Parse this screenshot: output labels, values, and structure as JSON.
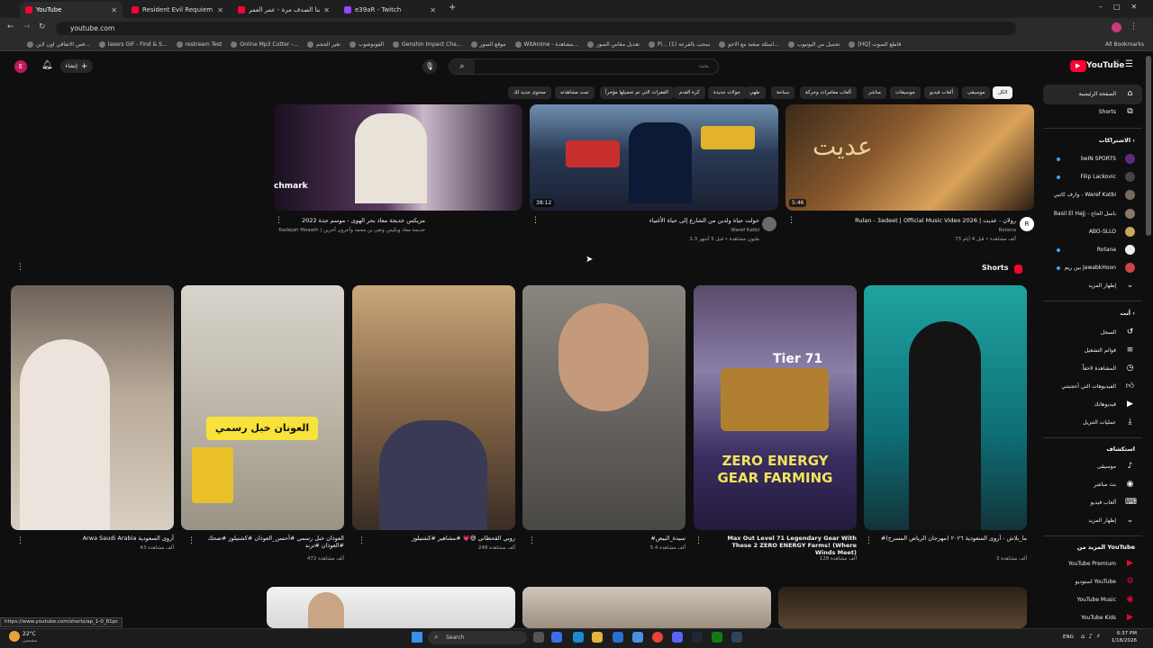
{
  "browser": {
    "tabs": [
      {
        "title": "YouTube"
      },
      {
        "title": "Resident Evil Requiem 💎 زوبام"
      },
      {
        "title": "تجمعنا الصدف مرة - عمر العمر"
      },
      {
        "title": "e39aR - Twitch"
      }
    ],
    "new_tab": "+",
    "url": "youtube.com",
    "bookmarks": [
      "فص الاتفاقي اون لاين...",
      "lasers GIF - Find & S...",
      "restream Test",
      "Online Mp3 Cutter -...",
      "تغير الحجم",
      "الفوتوشوب",
      "Genshin Impact Cha...",
      "موقع الصور",
      "WitAnime - مشاهدة...",
      "تعديل مقاس الصور",
      "Pi... (1) سحب بالقرعة",
      "اسئلة صعبة مع الاجو...",
      "تحميل من اليوتيوب",
      "[HQ] قاطع الصوت",
      "All Bookmarks"
    ]
  },
  "youtube": {
    "logo": "YouTube",
    "logo_region": "SA",
    "search_placeholder": "بحث",
    "create_label": "إنشاء",
    "avatar_letter": "E",
    "chips": [
      "الكل",
      "محتوى جديد لك",
      "تمت مشاهدته",
      "الفقرات التي تم تحميلها مؤخراً",
      "كرة القدم",
      "جولات جديدة",
      "طهي",
      "سباحة",
      "ألعاب مغامرات وحركة",
      "مباشر",
      "موسيقات",
      "ألعاب فيديو",
      "موسيقى",
      "الكل المحتوى"
    ],
    "top_videos": [
      {
        "title": "Rulan - 3adeet | Official Music Video 2026 | روﻻن - عديت",
        "channel": "Rotana",
        "meta": "73 ألف مشاهدة • قبل 4 أيام",
        "duration": "5:46",
        "thumb_text": "عديت"
      },
      {
        "title": "حولت حياة ولدين من الشارع إلى حياة الأغنياء",
        "channel": "Waref Katbi",
        "meta": "1.3 مليون مشاهدة • قبل 5 أشهر",
        "duration": "38:12",
        "thumb_text": ""
      },
      {
        "title": "مزيكس خديجة معاذ بحر الهوى - موسم جدة 2022",
        "channel": "Kadejah Moaath | خديجة معاذ ويكيس ونغي بن محمد وآخرون آخرين",
        "meta": "",
        "duration": "",
        "thumb_text": "chmark"
      }
    ],
    "shorts_heading": "Shorts",
    "shorts": [
      {
        "title": "Arwa Saudi Arabia أروى السعودية",
        "views": "43 ألف مشاهدة",
        "thumb_text": ""
      },
      {
        "title": "العوذان خبل رسمي #أحسن_العوذان #كشتيلوز #ضحك #العوذان #ترند",
        "views": "472 ألف مشاهدة",
        "thumb_text": "العونان خبل رسمي"
      },
      {
        "title": "روبي القحطاني 😅💗 #مشاهير #كشتيلوز",
        "views": "248 ألف مشاهدة",
        "thumb_text": ""
      },
      {
        "title": "#سيدة_البيض",
        "views": "5.4 ألف مشاهدة",
        "thumb_text": ""
      },
      {
        "title": "Max Out Level 71 Legendary Gear With These 2 ZERO ENERGY Farms! (Where Winds Meet)",
        "views": "128 ألف مشاهدة",
        "thumb_text": "ZERO ENERGY GEAR FARMING",
        "thumb_tier": "Tier 71"
      },
      {
        "title": "#ما_بلاش - أروى السعودية ٢٠٢٦ (مهرجان الرياض المسرح)",
        "views": "3 ألف مشاهدة",
        "thumb_text": ""
      }
    ],
    "sidebar": {
      "home": "الصفحة الرئيسية",
      "shorts": "Shorts",
      "subs_heading": "الاشتراكات",
      "subs": [
        "beIN SPORTS",
        "Filip Lackovic",
        "وارف كاتبي - Waref Katbi",
        "Basil El Hajj - باسل الحاج",
        "ABO-SLLO",
        "Rotana",
        "بين ريم JawabkHoon"
      ],
      "show_more": "إظهار المزيد",
      "you_heading": "أنت",
      "you_items": [
        "السجل",
        "قوائم التشغيل",
        "المشاهدة لاحقاً",
        "الفيديوهات التي أعجبتني",
        "فيديوهاتك",
        "عمليات التنزيل"
      ],
      "explore_heading": "استكشاف",
      "explore_items": [
        "موسيقى",
        "بث مباشر",
        "ألعاب فيديو",
        "إظهار المزيد"
      ],
      "more_heading": "المزيد من YouTube",
      "more_items": [
        "YouTube Premium",
        "استوديو YouTube",
        "YouTube Music",
        "YouTube Kids"
      ]
    }
  },
  "status_url": "https://www.youtube.com/shorts/ap_1-0_81pc",
  "taskbar": {
    "weather": "22°C",
    "weather_sub": "مشمس",
    "search": "Search",
    "lang": "ENG",
    "time": "6:37 PM",
    "date": "1/18/2026"
  }
}
